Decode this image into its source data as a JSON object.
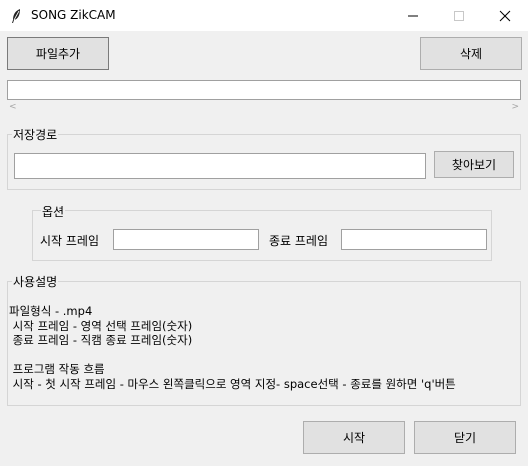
{
  "window": {
    "title": "SONG ZikCAM",
    "icon": "feather-icon",
    "controls": [
      "minimize",
      "maximize",
      "close"
    ]
  },
  "toolbar": {
    "add_file_label": "파일추가",
    "delete_label": "삭제"
  },
  "file_list": {
    "items": []
  },
  "save_path": {
    "group_label": "저장경로",
    "value": "",
    "browse_label": "찾아보기"
  },
  "options": {
    "group_label": "옵션",
    "start_frame_label": "시작 프레임",
    "start_frame_value": "",
    "end_frame_label": "종료 프레임",
    "end_frame_value": ""
  },
  "usage": {
    "group_label": "사용설명",
    "text": "파일형식 - .mp4\n 시작 프레임 - 영역 선택 프레임(숫자)\n 종료 프레임 - 직캠 종료 프레임(숫자)\n\n 프로그램 작동 흐름\n 시작 - 첫 시작 프레임 - 마우스 왼쪽클릭으로 영역 지정- space선택 - 종료를 원하면 'q'버튼"
  },
  "footer": {
    "start_label": "시작",
    "close_label": "닫기"
  }
}
